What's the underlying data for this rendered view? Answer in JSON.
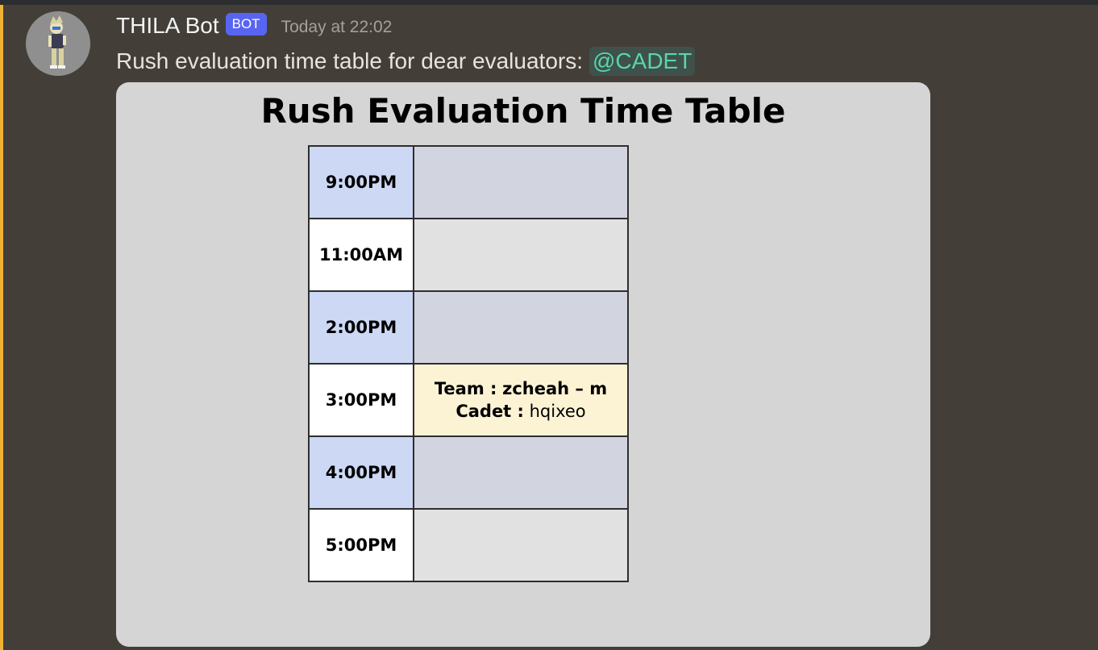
{
  "message": {
    "author": "THILA Bot",
    "badge": "BOT",
    "timestamp": "Today at 22:02",
    "text": "Rush evaluation time table for dear evaluators:",
    "mention": "@CADET"
  },
  "timetable": {
    "title": "Rush Evaluation Time Table",
    "rows": [
      {
        "time": "9:00PM"
      },
      {
        "time": "11:00AM"
      },
      {
        "time": "2:00PM"
      },
      {
        "time": "3:00PM",
        "team_label": "Team :",
        "team_value": "zcheah – m",
        "cadet_label": "Cadet :",
        "cadet_value": "hqixeo"
      },
      {
        "time": "4:00PM"
      },
      {
        "time": "5:00PM"
      }
    ]
  },
  "colors": {
    "background": "#433f38",
    "mention_bar": "#f0b232",
    "bot_badge": "#5865f2",
    "mention_text": "#58d6aa",
    "booked_slot": "#fcf3d5"
  }
}
